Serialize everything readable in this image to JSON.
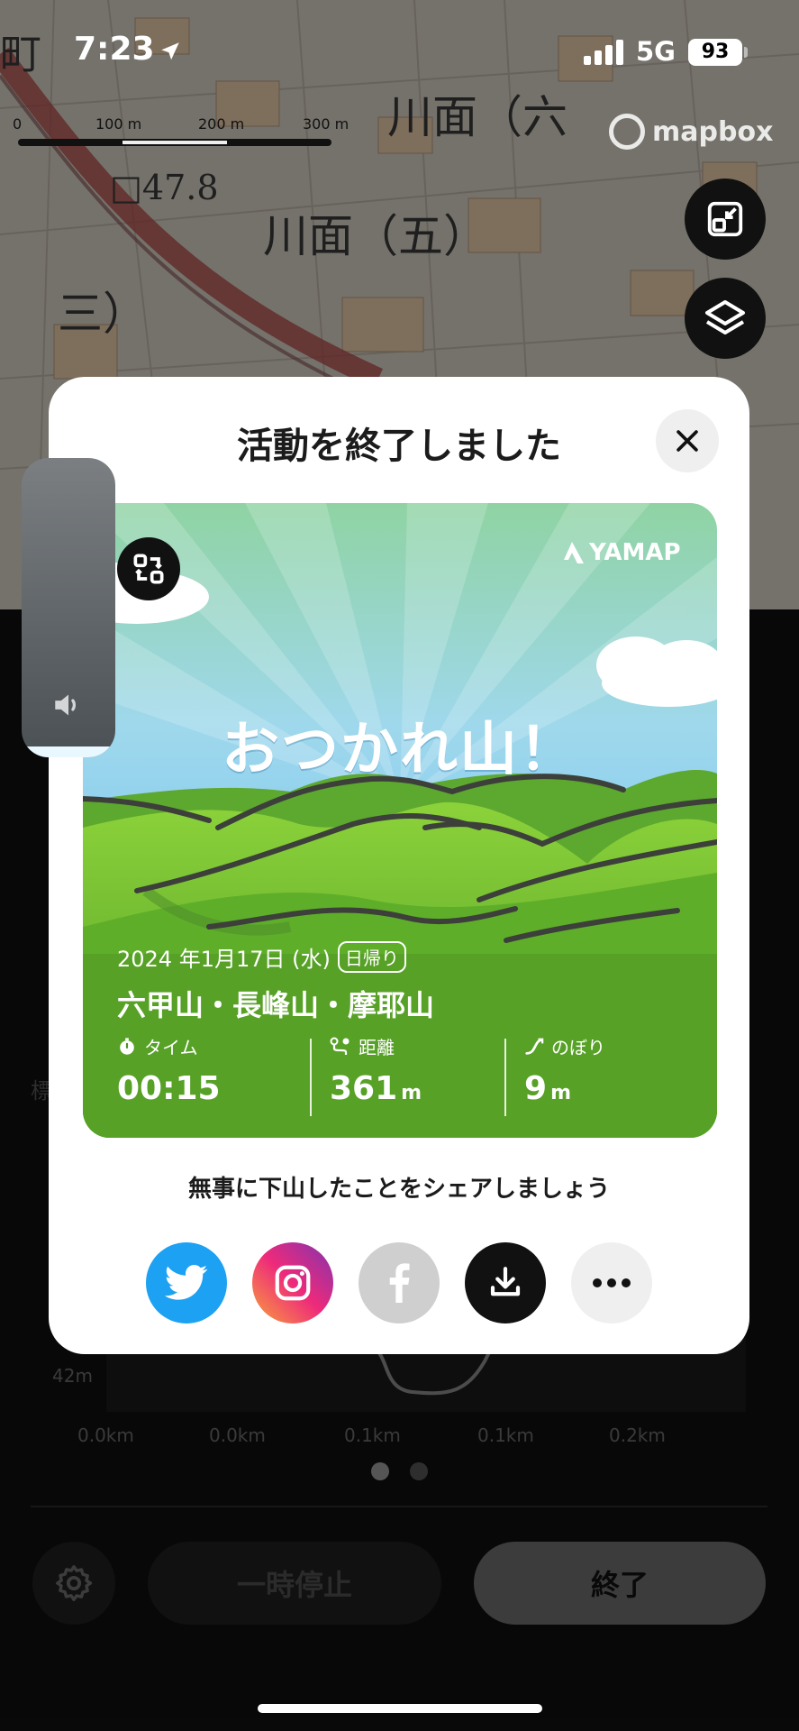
{
  "status_bar": {
    "time": "7:23",
    "network": "5G",
    "battery": "93"
  },
  "map": {
    "scale_labels": [
      "0",
      "100 m",
      "200 m",
      "300 m"
    ],
    "attribution": "mapbox",
    "labels": [
      "川面（六",
      "川面（五）",
      "□47.8",
      "三）",
      "町"
    ]
  },
  "modal": {
    "title": "活動を終了しました",
    "card": {
      "brand": "YAMAP",
      "headline": "おつかれ山！",
      "date": "2024 年1月17日 (水)",
      "trip_type": "日帰り",
      "mountains": "六甲山・長峰山・摩耶山",
      "stats": [
        {
          "label": "タイム",
          "value": "00:15",
          "unit": "",
          "icon": "stopwatch-icon"
        },
        {
          "label": "距離",
          "value": "361",
          "unit": "m",
          "icon": "route-icon"
        },
        {
          "label": "のぼり",
          "value": "9",
          "unit": "m",
          "icon": "ascent-icon"
        }
      ]
    },
    "share_text": "無事に下山したことをシェアしましょう",
    "share_buttons": [
      "twitter",
      "instagram",
      "facebook",
      "download",
      "more"
    ]
  },
  "sheet": {
    "side_label": "標",
    "elevation_label": "42m",
    "x_axis": [
      "0.0km",
      "0.0km",
      "0.1km",
      "0.1km",
      "0.2km"
    ],
    "page_dots": 2,
    "pause_label": "一時停止",
    "end_label": "終了"
  },
  "colors": {
    "twitter": "#1DA1F2",
    "facebook": "#cfcfcf",
    "grass": "#6bbd2c",
    "sky": "#9fd7ef"
  }
}
